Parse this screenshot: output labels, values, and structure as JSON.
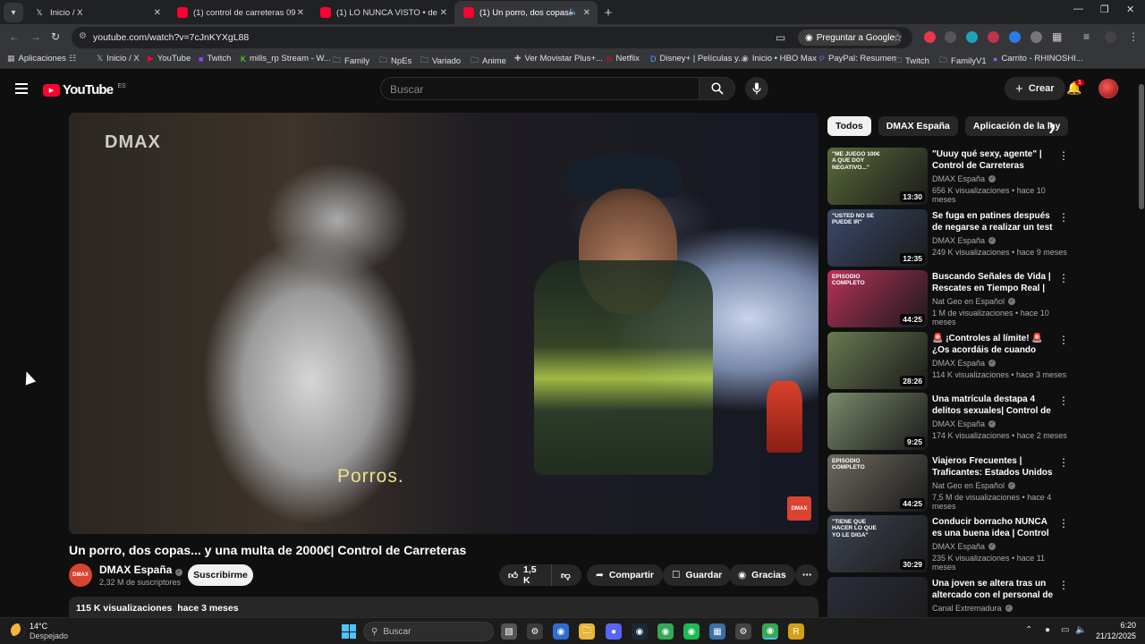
{
  "browser": {
    "tabs": [
      {
        "title": "Inicio / X",
        "icon": "x-logo-icon"
      },
      {
        "title": "(1) control de carreteras 09",
        "icon": "youtube-icon"
      },
      {
        "title": "(1) LO NUNCA VISTO • de",
        "icon": "youtube-icon"
      },
      {
        "title": "(1) Un porro, dos copas... y",
        "icon": "youtube-icon",
        "active": true
      }
    ],
    "url": "youtube.com/watch?v=7cJnKYXgL88",
    "ask_google": "Preguntar a Google",
    "bookmarks": [
      "Aplicaciones",
      "Inicio / X",
      "YouTube",
      "Twitch",
      "mills_rp Stream - W...",
      "Family",
      "NpEs",
      "Variado",
      "Anime",
      "Ver Movistar Plus+...",
      "Netflix",
      "Disney+ | Películas y...",
      "Inicio • HBO Max",
      "PayPal: Resumen",
      "Twitch",
      "FamilyV1",
      "Carrito - RHINOSHI..."
    ]
  },
  "youtube": {
    "logo": "YouTube",
    "region": "ES",
    "search_placeholder": "Buscar",
    "create_label": "Crear",
    "notification_count": "1"
  },
  "video": {
    "watermark": "DMAX",
    "subtitle": "Porros.",
    "corner_logo": "DMAX",
    "title": "Un porro, dos copas... y una multa de 2000€| Control de Carreteras",
    "channel": "DMAX España",
    "subscribers": "2,32 M de suscriptores",
    "subscribe_label": "Suscribirme",
    "likes": "1,5 K",
    "share_label": "Compartir",
    "save_label": "Guardar",
    "thanks_label": "Gracias",
    "views": "115 K visualizaciones",
    "age": "hace 3 meses"
  },
  "sidebar": {
    "chips": [
      "Todos",
      "DMAX España",
      "Aplicación de la ley"
    ],
    "recommendations": [
      {
        "title": "\"Uuuy qué sexy, agente\" | Control de Carreteras",
        "channel": "DMAX España",
        "meta": "656 K visualizaciones • hace 10 meses",
        "duration": "13:30",
        "caption": "\"Me juego 100€ a que doy negativo...\"",
        "color": "#5b6b3a"
      },
      {
        "title": "Se fuga en patines después de negarse a realizar un test de ...",
        "channel": "DMAX España",
        "meta": "249 K visualizaciones • hace 9 meses",
        "duration": "12:35",
        "caption": "\"Usted no se puede ir\"",
        "color": "#3c4a6a"
      },
      {
        "title": "Buscando Señales de Vida | Rescates en Tiempo Real | Nat...",
        "channel": "Nat Geo en Español",
        "meta": "1 M de visualizaciones • hace 10 meses",
        "duration": "44:25",
        "caption": "Episodio completo",
        "color": "#b8325c"
      },
      {
        "title": "🚨 ¡Controles al límite! 🚨 ¿Os acordáis de cuando nos ...",
        "channel": "DMAX España",
        "meta": "114 K visualizaciones • hace 3 meses",
        "duration": "28:26",
        "caption": "",
        "color": "#6a7a50"
      },
      {
        "title": "Una matrícula destapa 4 delitos sexuales| Control de Carreteras",
        "channel": "DMAX España",
        "meta": "174 K visualizaciones • hace 2 meses",
        "duration": "9:25",
        "caption": "",
        "color": "#7a8a6a"
      },
      {
        "title": "Viajeros Frecuentes | Traficantes: Estados Unidos | ...",
        "channel": "Nat Geo en Español",
        "meta": "7,5 M de visualizaciones • hace 4 meses",
        "duration": "44:25",
        "caption": "Episodio completo",
        "color": "#6d6a5e"
      },
      {
        "title": "Conducir borracho NUNCA es una buena idea | Control de ...",
        "channel": "DMAX España",
        "meta": "235 K visualizaciones • hace 11 meses",
        "duration": "30:29",
        "caption": "\"Tiene que hacer lo que yo le diga\"",
        "color": "#3d4450"
      },
      {
        "title": "Una joven se altera tras un altercado con el personal de ...",
        "channel": "Canal Extremadura",
        "meta": "",
        "duration": "",
        "caption": "",
        "color": "#2b2e3a"
      }
    ]
  },
  "taskbar": {
    "temperature": "14°C",
    "weather": "Despejado",
    "search_placeholder": "Buscar",
    "time": "6:20",
    "date": "21/12/2025"
  }
}
